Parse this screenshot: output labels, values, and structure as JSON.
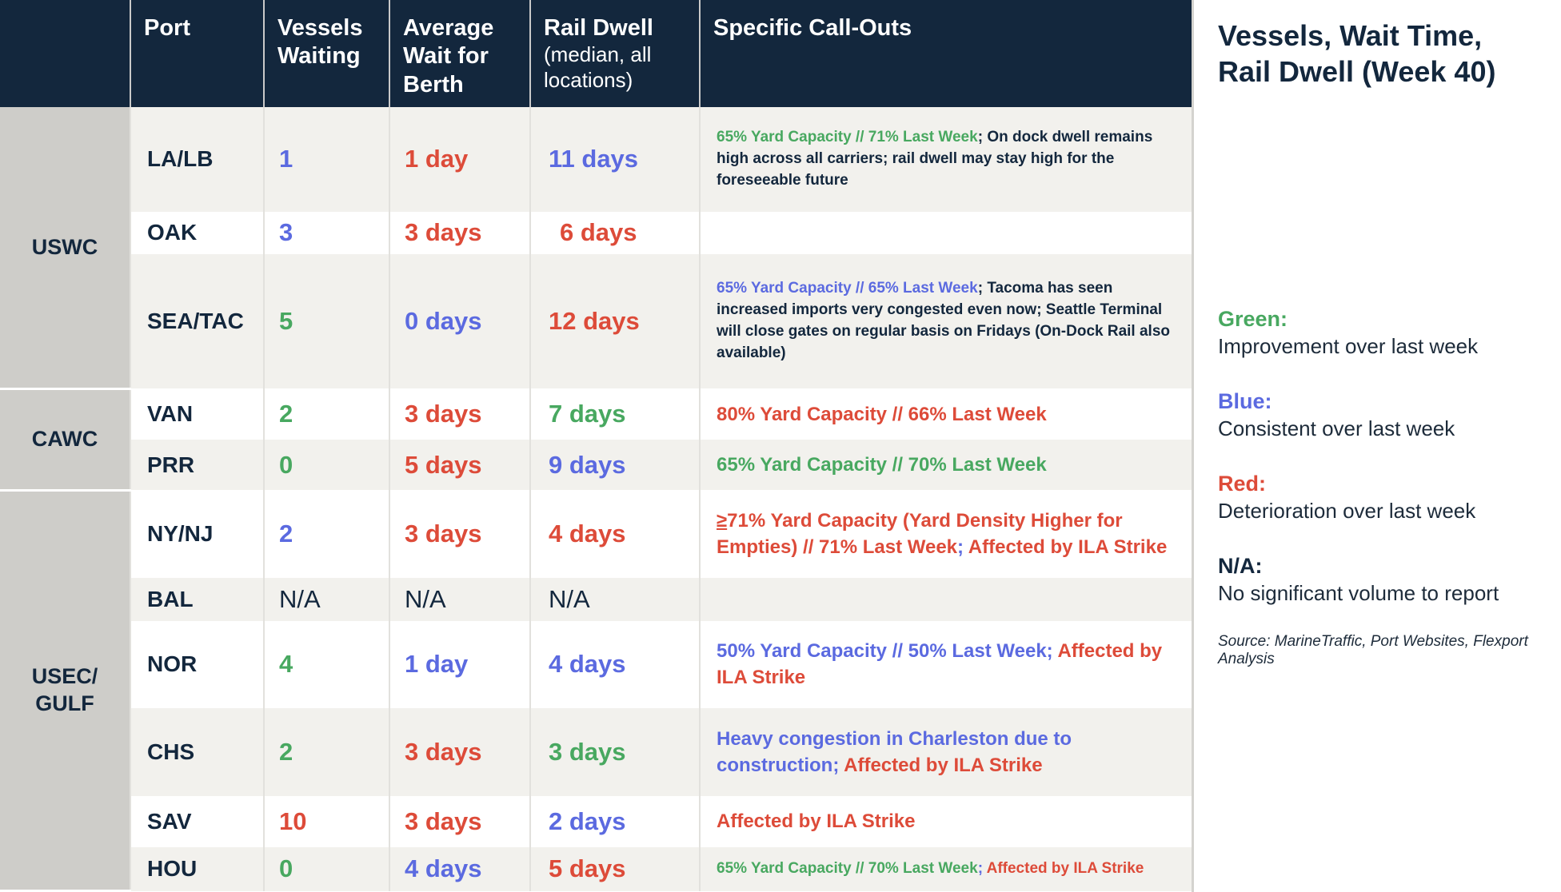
{
  "table": {
    "headers": {
      "group": "",
      "port": "Port",
      "vessels_waiting": "Vessels Waiting",
      "average_wait": "Average Wait for Berth",
      "rail_dwell_main": "Rail Dwell",
      "rail_dwell_sub": "(median, all locations)",
      "callouts": "Specific Call-Outs"
    },
    "groups": [
      {
        "label": "USWC",
        "rows": 3
      },
      {
        "label": "CAWC",
        "rows": 2
      },
      {
        "label": "USEC/ GULF",
        "rows": 6
      }
    ],
    "rows": [
      {
        "port": "LA/LB",
        "vessels": "1",
        "vessels_color": "blue",
        "wait": "1 day",
        "wait_color": "red",
        "rail": "11 days",
        "rail_color": "blue",
        "callout_size": "small",
        "callout": [
          {
            "text": "65% Yard Capacity // 71% Last Week",
            "color": "green"
          },
          {
            "text": "; ",
            "color": "navy"
          },
          {
            "text": "On dock dwell remains high across all carriers; rail dwell may stay high for the foreseeable future",
            "color": "navy"
          }
        ]
      },
      {
        "port": "OAK",
        "vessels": "3",
        "vessels_color": "blue",
        "wait": "3 days",
        "wait_color": "red",
        "rail": "6 days",
        "rail_color": "red",
        "rail_indent": true,
        "callout_size": "small",
        "callout": []
      },
      {
        "port": "SEA/TAC",
        "vessels": "5",
        "vessels_color": "green",
        "wait": "0 days",
        "wait_color": "blue",
        "rail": "12 days",
        "rail_color": "red",
        "callout_size": "small",
        "callout": [
          {
            "text": "65% Yard Capacity // 65% Last Week",
            "color": "blue"
          },
          {
            "text": "; ",
            "color": "navy"
          },
          {
            "text": "Tacoma has seen increased imports very congested even now; Seattle Terminal will close gates on regular basis on Fridays (On-Dock Rail also available)",
            "color": "navy"
          }
        ]
      },
      {
        "port": "VAN",
        "vessels": "2",
        "vessels_color": "green",
        "wait": "3 days",
        "wait_color": "red",
        "rail": "7 days",
        "rail_color": "green",
        "callout_size": "big",
        "callout": [
          {
            "text": "80% Yard Capacity // 66% Last Week",
            "color": "red"
          }
        ]
      },
      {
        "port": "PRR",
        "vessels": "0",
        "vessels_color": "green",
        "wait": "5 days",
        "wait_color": "red",
        "rail": "9 days",
        "rail_color": "blue",
        "callout_size": "big",
        "callout": [
          {
            "text": "65% Yard Capacity // 70% Last Week",
            "color": "green"
          }
        ]
      },
      {
        "port": "NY/NJ",
        "vessels": "2",
        "vessels_color": "blue",
        "wait": "3 days",
        "wait_color": "red",
        "rail": "4 days",
        "rail_color": "red",
        "callout_size": "big",
        "callout": [
          {
            "text": "≥",
            "color": "red",
            "underline": true
          },
          {
            "text": "71% Yard Capacity (Yard Density Higher for Empties) // 71% Last Week",
            "color": "red"
          },
          {
            "text": "; ",
            "color": "blue"
          },
          {
            "text": "Affected by ILA Strike",
            "color": "red"
          }
        ]
      },
      {
        "port": "BAL",
        "vessels": "N/A",
        "vessels_color": "na",
        "wait": "N/A",
        "wait_color": "na",
        "rail": "N/A",
        "rail_color": "na",
        "callout_size": "big",
        "callout": []
      },
      {
        "port": "NOR",
        "vessels": "4",
        "vessels_color": "green",
        "wait": "1 day",
        "wait_color": "blue",
        "rail": "4 days",
        "rail_color": "blue",
        "callout_size": "big",
        "callout": [
          {
            "text": "50% Yard Capacity // 50% Last Week",
            "color": "blue"
          },
          {
            "text": "; ",
            "color": "blue"
          },
          {
            "text": "Affected by ILA Strike",
            "color": "red"
          }
        ]
      },
      {
        "port": "CHS",
        "vessels": "2",
        "vessels_color": "green",
        "wait": "3 days",
        "wait_color": "red",
        "rail": "3 days",
        "rail_color": "green",
        "callout_size": "big",
        "callout": [
          {
            "text": "Heavy congestion in Charleston due to construction",
            "color": "blue"
          },
          {
            "text": "; ",
            "color": "blue"
          },
          {
            "text": "Affected by ILA Strike",
            "color": "red"
          }
        ]
      },
      {
        "port": "SAV",
        "vessels": "10",
        "vessels_color": "red",
        "wait": "3 days",
        "wait_color": "red",
        "rail": "2 days",
        "rail_color": "blue",
        "callout_size": "big",
        "callout": [
          {
            "text": "Affected by ILA Strike",
            "color": "red"
          }
        ]
      },
      {
        "port": "HOU",
        "vessels": "0",
        "vessels_color": "green",
        "wait": "4 days",
        "wait_color": "blue",
        "rail": "5 days",
        "rail_color": "red",
        "callout_size": "small",
        "callout": [
          {
            "text": "65% Yard Capacity // 70% Last Week",
            "color": "green"
          },
          {
            "text": "; ",
            "color": "blue"
          },
          {
            "text": "Affected by ILA Strike",
            "color": "red"
          }
        ]
      }
    ]
  },
  "panel": {
    "title": "Vessels, Wait Time, Rail Dwell (Week 40)",
    "legend": [
      {
        "term": "Green:",
        "term_color": "green",
        "desc": "Improvement over last week"
      },
      {
        "term": "Blue:",
        "term_color": "blue",
        "desc": "Consistent over last week"
      },
      {
        "term": "Red:",
        "term_color": "red",
        "desc": "Deterioration over last week"
      },
      {
        "term": "N/A:",
        "term_color": "navy",
        "desc": "No significant volume to report"
      }
    ],
    "source": "Source: MarineTraffic, Port Websites, Flexport Analysis"
  },
  "colors": {
    "header_bg": "#13273d",
    "group_bg": "#cecdc9",
    "row_alt_bg": "#f2f1ed",
    "green": "#48a860",
    "blue": "#5b6ae0",
    "red": "#dd4b39",
    "navy": "#13273d"
  }
}
